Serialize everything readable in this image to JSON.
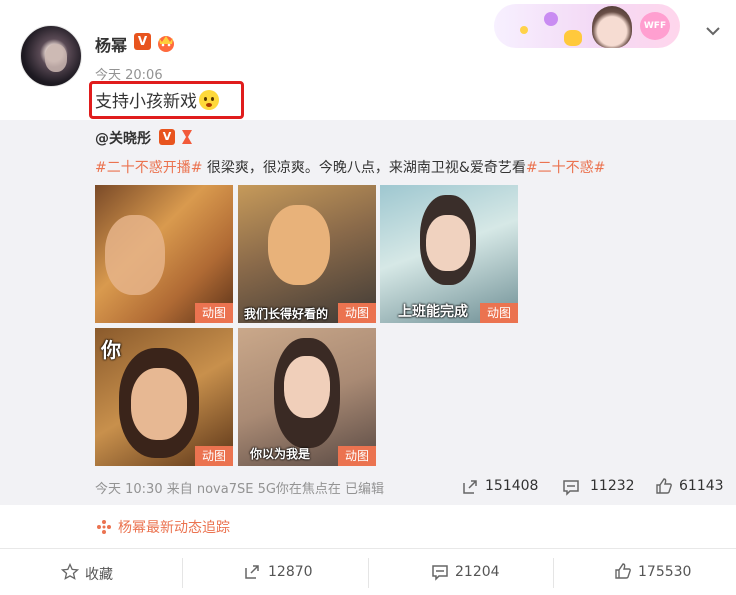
{
  "post": {
    "author": "杨幂",
    "verified_label": "V",
    "time": "今天 20:06",
    "text": "支持小孩新戏"
  },
  "repost": {
    "author": "@关晓彤",
    "verified_label": "V",
    "tag1": "#二十不惑开播#",
    "body": " 很梁爽，很凉爽。今晚八点，来湖南卫视&爱奇艺看",
    "tag2": "#二十不惑#",
    "images": [
      {
        "badge": "动图",
        "caption": ""
      },
      {
        "badge": "动图",
        "caption": "我们长得好看的"
      },
      {
        "badge": "动图",
        "caption": "上班能完成"
      },
      {
        "badge": "动图",
        "caption": "你"
      },
      {
        "badge": "动图",
        "caption": "你以为我是"
      }
    ],
    "meta": "今天 10:30 来自 nova7SE 5G你在焦点在   已编辑",
    "reposts": "151408",
    "comments": "11232",
    "likes": "61143"
  },
  "follow_link": "杨幂最新动态追踪",
  "actions": {
    "favorite": "收藏",
    "reposts": "12870",
    "comments": "21204",
    "likes": "175530"
  },
  "banner": {
    "badge": "WFF"
  },
  "colors": {
    "tag": "#eb7350",
    "highlight_box": "#e01c1c",
    "verified": "#e8541e"
  }
}
